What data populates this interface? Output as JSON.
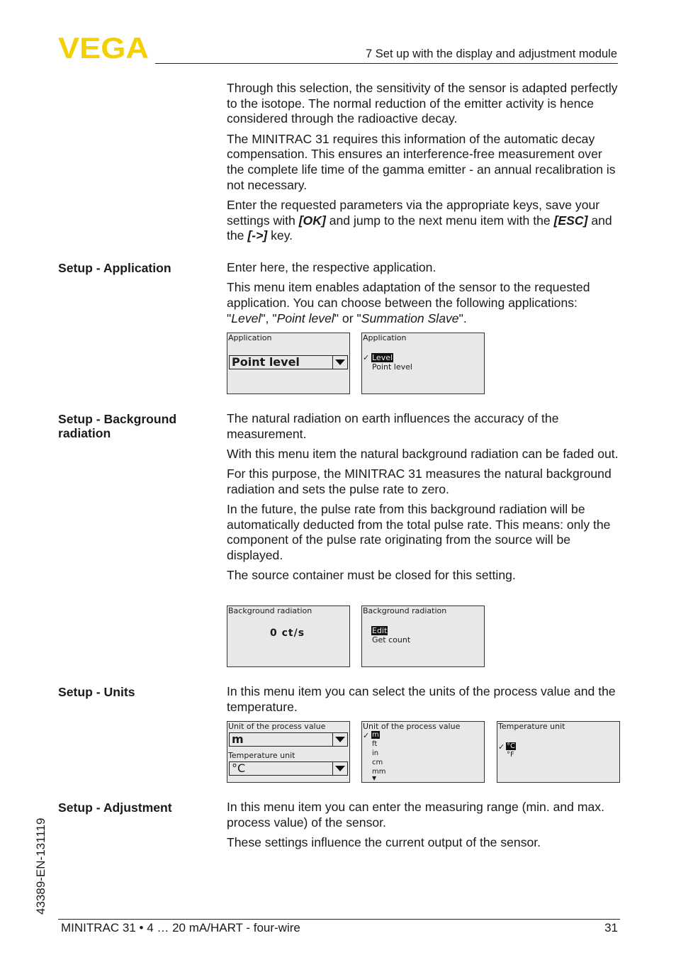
{
  "header": {
    "logo": "VEGA",
    "chapter": "7 Set up with the display and adjustment module",
    "brand_color": "#f5d000"
  },
  "intro": [
    [
      {
        "t": "Through this selection, the sensitivity of the sensor is adapted perfectly to the isotope. The normal reduction of the emitter activity is hence considered through the radioactive decay."
      }
    ],
    [
      {
        "t": "The MINITRAC 31 requires this information of the automatic decay compensation. This ensures an interference-free measurement over the complete life time of the gamma emitter - an annual recalibration is not necessary."
      }
    ],
    [
      {
        "t": "Enter the requested parameters via the appropriate keys, save your settings with "
      },
      {
        "t": "[OK]",
        "s": "bi"
      },
      {
        "t": " and jump to the next menu item with the "
      },
      {
        "t": "[ESC]",
        "s": "bi"
      },
      {
        "t": " and the "
      },
      {
        "t": "[->]",
        "s": "bi"
      },
      {
        "t": " key."
      }
    ]
  ],
  "application": {
    "label": "Setup - Application",
    "paras": [
      [
        {
          "t": "Enter here, the respective application."
        }
      ],
      [
        {
          "t": "This menu item enables adaptation of the sensor to the requested application. You can choose between the following applications: \""
        },
        {
          "t": "Level",
          "s": "i"
        },
        {
          "t": "\", \""
        },
        {
          "t": "Point level",
          "s": "i"
        },
        {
          "t": "\" or \""
        },
        {
          "t": "Summation Slave",
          "s": "i"
        },
        {
          "t": "\"."
        }
      ]
    ],
    "screen1": {
      "title": "Application",
      "value": "Point level"
    },
    "screen2": {
      "title": "Application",
      "options": [
        "Level",
        "Point level"
      ],
      "selected": "Level"
    }
  },
  "background": {
    "label_line1": "Setup - Background",
    "label_line2": "radiation",
    "paras": [
      [
        {
          "t": "The natural radiation on earth influences the accuracy of the measurement."
        }
      ],
      [
        {
          "t": "With this menu item the natural background radiation can be faded out."
        }
      ],
      [
        {
          "t": "For this purpose, the MINITRAC 31 measures the natural background radiation and sets the pulse rate to zero."
        }
      ],
      [
        {
          "t": "In the future, the pulse rate from this background radiation will be automatically deducted from the total pulse rate. This means: only the component of the pulse rate originating from the source will be displayed."
        }
      ],
      [
        {
          "t": "The source container must be closed for this setting."
        }
      ]
    ],
    "screen1": {
      "title": "Background radiation",
      "value": "0 ct/s"
    },
    "screen2": {
      "title": "Background radiation",
      "options": [
        "Edit",
        "Get count"
      ]
    }
  },
  "units": {
    "label": "Setup - Units",
    "paras": [
      [
        {
          "t": "In this menu item you can select the units of the process value and the temperature."
        }
      ]
    ],
    "screen1": {
      "title1": "Unit of the process value",
      "value1": "m",
      "title2": "Temperature unit",
      "value2": "°C"
    },
    "screen2": {
      "title": "Unit of the process value",
      "options": [
        "m",
        "ft",
        "in",
        "cm",
        "mm"
      ]
    },
    "screen3": {
      "title": "Temperature unit",
      "options": [
        "°C",
        "°F"
      ]
    }
  },
  "adjustment": {
    "label": "Setup - Adjustment",
    "paras": [
      [
        {
          "t": "In this menu item you can enter the measuring range (min. and max. process value) of the sensor."
        }
      ],
      [
        {
          "t": "These settings influence the current output of the sensor."
        }
      ]
    ]
  },
  "footer": {
    "text": "MINITRAC 31 • 4 … 20 mA/HART - four-wire",
    "page": "31",
    "doc_id": "43389-EN-131119"
  }
}
